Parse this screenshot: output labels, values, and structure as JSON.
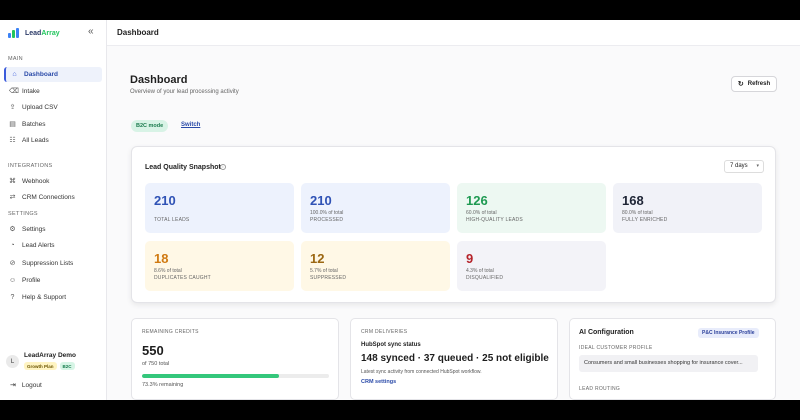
{
  "sidebar": {
    "brand": {
      "name_a": "Lead",
      "name_b": "Array"
    },
    "sections": {
      "main": "MAIN",
      "integrations": "INTEGRATIONS",
      "settings": "SETTINGS"
    },
    "items": [
      {
        "label": "Dashboard",
        "icon": "home-icon",
        "active": true
      },
      {
        "label": "Intake",
        "icon": "inbox-icon"
      },
      {
        "label": "Upload CSV",
        "icon": "upload-icon"
      },
      {
        "label": "Batches",
        "icon": "layers-icon"
      },
      {
        "label": "All Leads",
        "icon": "users-icon"
      },
      {
        "label": "Webhook",
        "icon": "webhook-icon"
      },
      {
        "label": "CRM Connections",
        "icon": "link-icon"
      },
      {
        "label": "Settings",
        "icon": "gear-icon"
      },
      {
        "label": "Lead Alerts",
        "icon": "bell-icon"
      },
      {
        "label": "Suppression Lists",
        "icon": "ban-icon"
      },
      {
        "label": "Profile",
        "icon": "user-icon"
      },
      {
        "label": "Help & Support",
        "icon": "help-icon"
      }
    ],
    "user": {
      "initial": "L",
      "name": "LeadArray Demo",
      "plan": "Growth Plan",
      "mode": "B2C"
    },
    "logout": "Logout"
  },
  "topbar": {
    "title": "Dashboard"
  },
  "page": {
    "title": "Dashboard",
    "subtitle": "Overview of your lead processing activity",
    "refresh": "Refresh",
    "mode_badge": "B2C mode",
    "switch": "Switch"
  },
  "snapshot": {
    "title": "Lead Quality Snapshot",
    "range": "7 days",
    "stats": [
      {
        "value": "210",
        "pct": "",
        "label": "TOTAL LEADS",
        "tone": "blue"
      },
      {
        "value": "210",
        "pct": "100.0% of total",
        "label": "PROCESSED",
        "tone": "blue"
      },
      {
        "value": "126",
        "pct": "60.0% of total",
        "label": "HIGH-QUALITY LEADS",
        "tone": "green"
      },
      {
        "value": "168",
        "pct": "80.0% of total",
        "label": "FULLY ENRICHED",
        "tone": "gray"
      },
      {
        "value": "18",
        "pct": "8.6% of total",
        "label": "DUPLICATES CAUGHT",
        "tone": "orange"
      },
      {
        "value": "12",
        "pct": "5.7% of total",
        "label": "SUPPRESSED",
        "tone": "brown"
      },
      {
        "value": "9",
        "pct": "4.3% of total",
        "label": "DISQUALIFIED",
        "tone": "red"
      }
    ]
  },
  "credits": {
    "heading": "REMAINING CREDITS",
    "value": "550",
    "total": "of 750 total",
    "fraction": 0.733,
    "remaining": "73.3% remaining"
  },
  "crm": {
    "heading": "CRM DELIVERIES",
    "title": "HubSpot sync status",
    "counts": "148 synced · 37 queued · 25 not eligible",
    "desc": "Latest sync activity from connected HubSpot workflow.",
    "link": "CRM settings"
  },
  "ai": {
    "title": "AI Configuration",
    "badge": "P&C Insurance Profile",
    "profile_label": "IDEAL CUSTOMER PROFILE",
    "profile_value": "Consumers and small businesses shopping for insurance cover...",
    "routing_label": "LEAD ROUTING"
  }
}
